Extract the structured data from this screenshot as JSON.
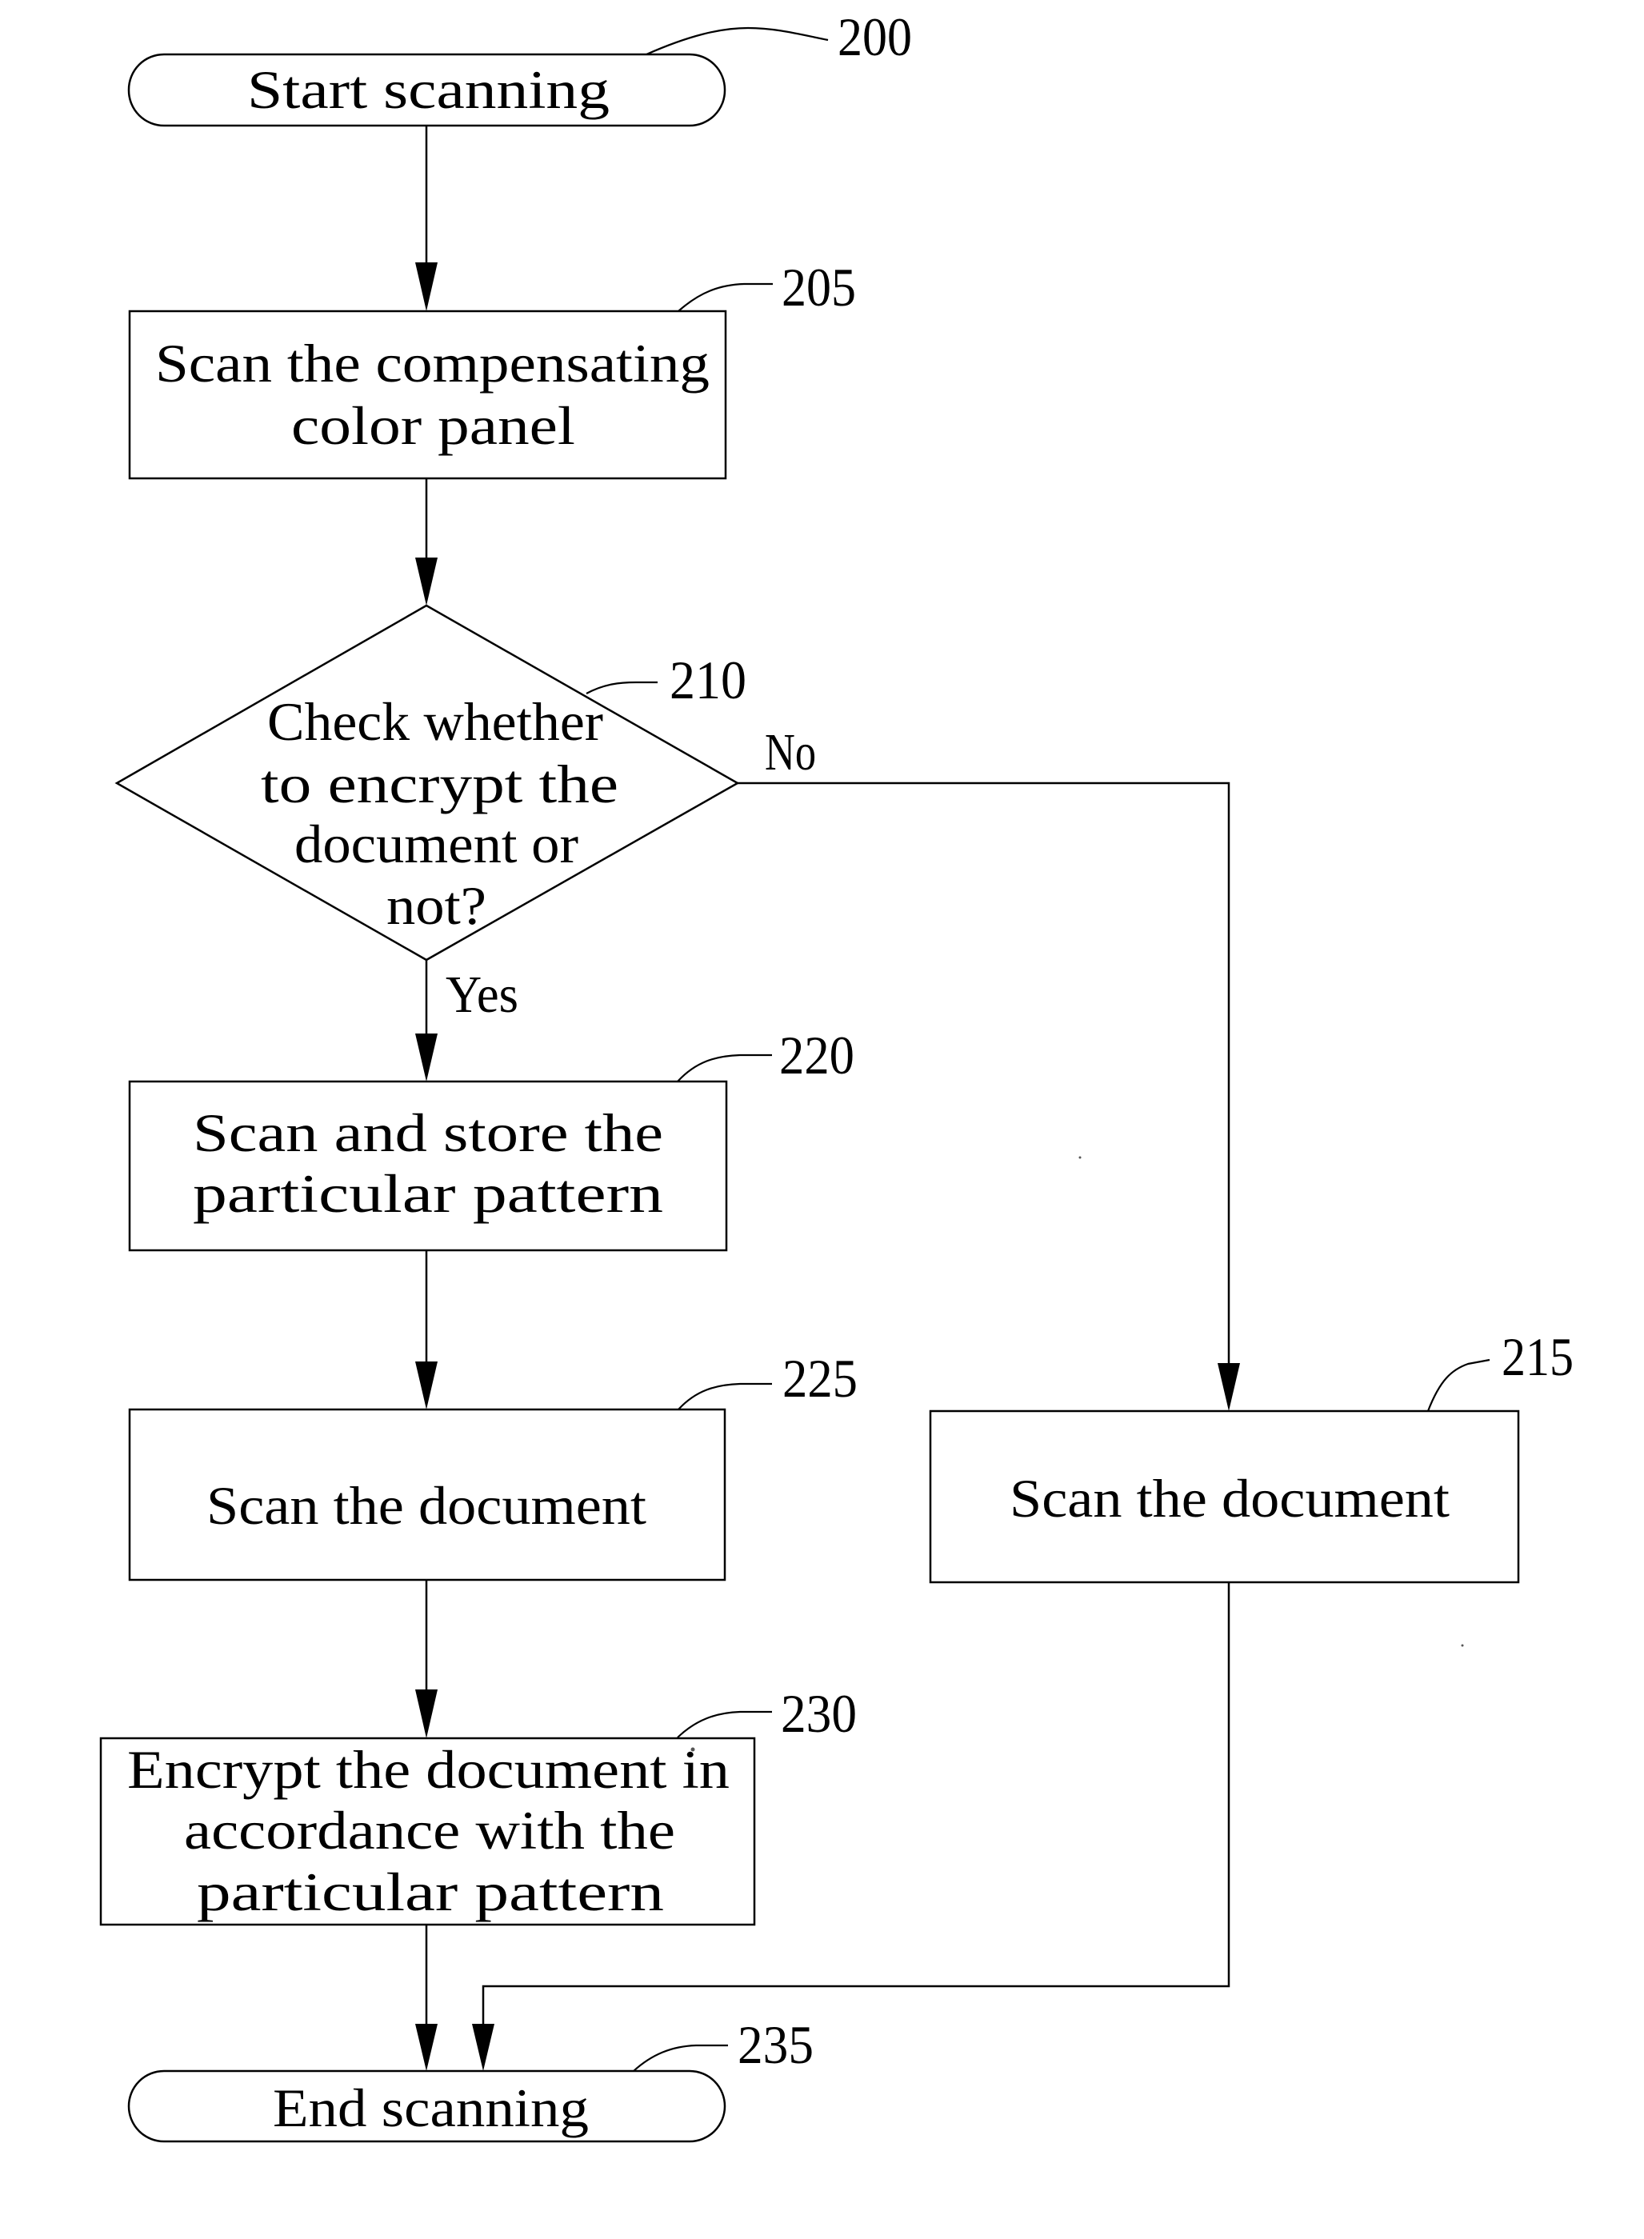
{
  "figure": {
    "type": "flowchart",
    "nodes": {
      "start": {
        "ref": "200",
        "shape": "terminal",
        "lines": [
          "Start scanning"
        ]
      },
      "scan_panel": {
        "ref": "205",
        "shape": "process",
        "lines": [
          "Scan the compensating",
          "color panel"
        ]
      },
      "decision": {
        "ref": "210",
        "shape": "decision",
        "lines": [
          "Check whether",
          "to encrypt the",
          "document or",
          "not?"
        ]
      },
      "scan_doc_plain": {
        "ref": "215",
        "shape": "process",
        "lines": [
          "Scan the document"
        ]
      },
      "store_pattern": {
        "ref": "220",
        "shape": "process",
        "lines": [
          "Scan and store the",
          "particular pattern"
        ]
      },
      "scan_doc": {
        "ref": "225",
        "shape": "process",
        "lines": [
          "Scan the document"
        ]
      },
      "encrypt": {
        "ref": "230",
        "shape": "process",
        "lines": [
          "Encrypt the document in",
          "accordance with the",
          "particular pattern"
        ]
      },
      "end": {
        "ref": "235",
        "shape": "terminal",
        "lines": [
          "End scanning"
        ]
      }
    },
    "branches": {
      "yes": "Yes",
      "no": "No"
    },
    "edges": [
      {
        "from": "200",
        "to": "205"
      },
      {
        "from": "205",
        "to": "210"
      },
      {
        "from": "210",
        "to": "220",
        "label": "Yes"
      },
      {
        "from": "210",
        "to": "215",
        "label": "No"
      },
      {
        "from": "220",
        "to": "225"
      },
      {
        "from": "225",
        "to": "230"
      },
      {
        "from": "230",
        "to": "235"
      },
      {
        "from": "215",
        "to": "235"
      }
    ]
  }
}
